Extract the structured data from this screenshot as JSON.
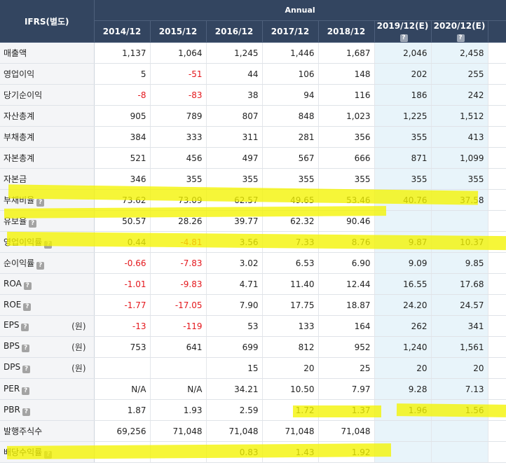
{
  "header": {
    "ifrs_label": "IFRS(별도)",
    "annual_label": "Annual",
    "years": [
      "2014/12",
      "2015/12",
      "2016/12",
      "2017/12",
      "2018/12",
      "2019/12(E)",
      "2020/12(E)"
    ],
    "help_icon_glyph": "?"
  },
  "colors": {
    "header_bg": "#334560",
    "negative": "#e4161b",
    "estimate_bg": "#e8f4fa",
    "highlight": "#f4f400"
  },
  "rows": [
    {
      "label": "매출액",
      "values": [
        "1,137",
        "1,064",
        "1,245",
        "1,446",
        "1,687",
        "2,046",
        "2,458"
      ]
    },
    {
      "label": "영업이익",
      "values": [
        "5",
        "-51",
        "44",
        "106",
        "148",
        "202",
        "255"
      ]
    },
    {
      "label": "당기순이익",
      "values": [
        "-8",
        "-83",
        "38",
        "94",
        "116",
        "186",
        "242"
      ]
    },
    {
      "label": "자산총계",
      "values": [
        "905",
        "789",
        "807",
        "848",
        "1,023",
        "1,225",
        "1,512"
      ]
    },
    {
      "label": "부채총계",
      "values": [
        "384",
        "333",
        "311",
        "281",
        "356",
        "355",
        "413"
      ]
    },
    {
      "label": "자본총계",
      "values": [
        "521",
        "456",
        "497",
        "567",
        "666",
        "871",
        "1,099"
      ]
    },
    {
      "label": "자본금",
      "values": [
        "346",
        "355",
        "355",
        "355",
        "355",
        "355",
        "355"
      ]
    },
    {
      "label": "부채비율",
      "help": "?",
      "values": [
        "73.62",
        "73.09",
        "62.57",
        "49.65",
        "53.46",
        "40.76",
        "37.58"
      ]
    },
    {
      "label": "유보율",
      "help": "?",
      "values": [
        "50.57",
        "28.26",
        "39.77",
        "62.32",
        "90.46",
        "",
        ""
      ]
    },
    {
      "label": "영업이익률",
      "help": "?",
      "values": [
        "0.44",
        "-4.81",
        "3.56",
        "7.33",
        "8.76",
        "9.87",
        "10.37"
      ]
    },
    {
      "label": "순이익률",
      "help": "?",
      "values": [
        "-0.66",
        "-7.83",
        "3.02",
        "6.53",
        "6.90",
        "9.09",
        "9.85"
      ]
    },
    {
      "label": "ROA",
      "help": "?",
      "values": [
        "-1.01",
        "-9.83",
        "4.71",
        "11.40",
        "12.44",
        "16.55",
        "17.68"
      ]
    },
    {
      "label": "ROE",
      "help": "?",
      "values": [
        "-1.77",
        "-17.05",
        "7.90",
        "17.75",
        "18.87",
        "24.20",
        "24.57"
      ]
    },
    {
      "label": "EPS",
      "help": "?",
      "unit": "(원)",
      "values": [
        "-13",
        "-119",
        "53",
        "133",
        "164",
        "262",
        "341"
      ]
    },
    {
      "label": "BPS",
      "help": "?",
      "unit": "(원)",
      "values": [
        "753",
        "641",
        "699",
        "812",
        "952",
        "1,240",
        "1,561"
      ]
    },
    {
      "label": "DPS",
      "help": "?",
      "unit": "(원)",
      "values": [
        "",
        "",
        "15",
        "20",
        "25",
        "20",
        "20"
      ]
    },
    {
      "label": "PER",
      "help": "?",
      "values": [
        "N/A",
        "N/A",
        "34.21",
        "10.50",
        "7.97",
        "9.28",
        "7.13"
      ]
    },
    {
      "label": "PBR",
      "help": "?",
      "values": [
        "1.87",
        "1.93",
        "2.59",
        "1.72",
        "1.37",
        "1.96",
        "1.56"
      ]
    },
    {
      "label": "발행주식수",
      "values": [
        "69,256",
        "71,048",
        "71,048",
        "71,048",
        "71,048",
        "",
        ""
      ]
    },
    {
      "label": "배당수익률",
      "help": "?",
      "values": [
        "",
        "",
        "0.83",
        "1.43",
        "1.92",
        "",
        ""
      ]
    }
  ]
}
